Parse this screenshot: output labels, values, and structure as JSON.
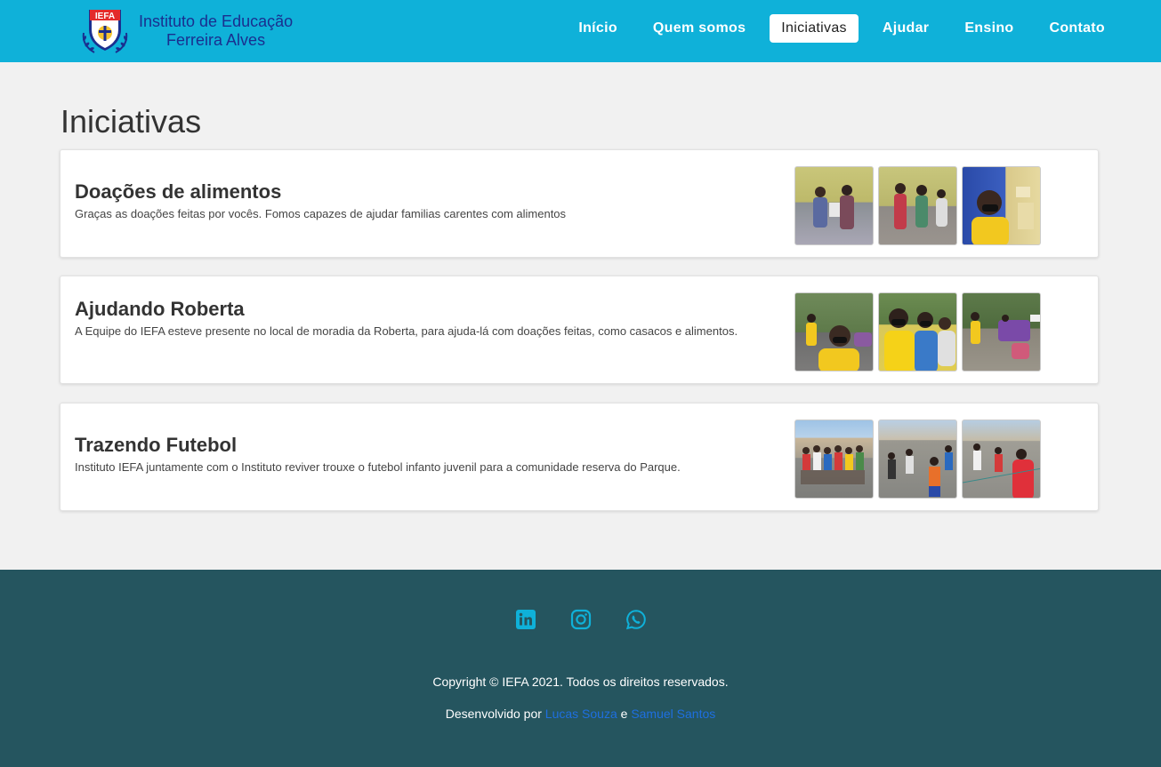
{
  "header": {
    "logo_text": "IEFA",
    "brand_line1": "Instituto de Educação",
    "brand_line2": "Ferreira Alves",
    "nav": [
      {
        "label": "Início"
      },
      {
        "label": "Quem somos"
      },
      {
        "label": "Iniciativas",
        "active": true
      },
      {
        "label": "Ajudar"
      },
      {
        "label": "Ensino"
      },
      {
        "label": "Contato"
      }
    ]
  },
  "main": {
    "title": "Iniciativas",
    "cards": [
      {
        "title": "Doações de alimentos",
        "description": "Graças as doações feitas por vocês. Fomos capazes de ajudar familias carentes com alimentos"
      },
      {
        "title": "Ajudando Roberta",
        "description": "A Equipe do IEFA esteve presente no local de moradia da Roberta, para ajuda-lá com doações feitas, como casacos e alimentos."
      },
      {
        "title": "Trazendo Futebol",
        "description": "Instituto IEFA juntamente com o Instituto reviver trouxe o futebol infanto juvenil para a comunidade reserva do Parque."
      }
    ]
  },
  "footer": {
    "social_icons": [
      "linkedin-icon",
      "instagram-icon",
      "whatsapp-icon"
    ],
    "copyright": "Copyright © IEFA 2021. Todos os direitos reservados.",
    "dev_prefix": "Desenvolvido por",
    "dev1": "Lucas Souza",
    "dev_sep": "e",
    "dev2": "Samuel Santos"
  },
  "colors": {
    "navbar": "#0fb1d9",
    "footer": "#25555f",
    "brand_text": "#1a2f8f",
    "link": "#1e6fe0",
    "social_icon": "#0fb1d9"
  }
}
